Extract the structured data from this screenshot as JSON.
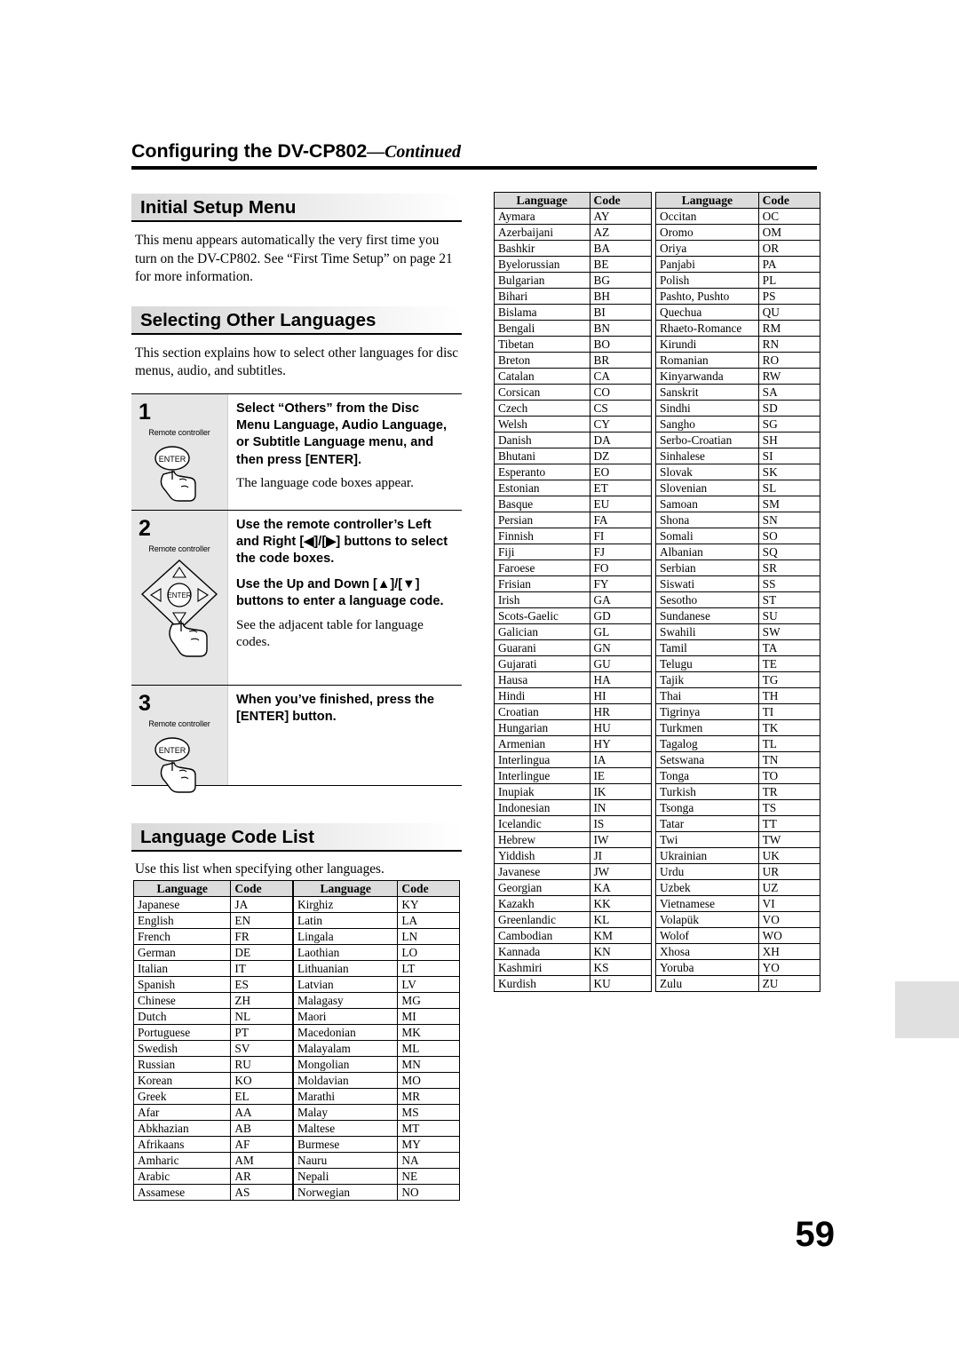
{
  "header": {
    "title": "Configuring the DV-CP802",
    "continued": "—Continued"
  },
  "sections": {
    "initial_setup": {
      "title": "Initial Setup Menu",
      "body": "This menu appears automatically the very first time you turn on the DV-CP802. See “First Time Setup” on page 21 for more information."
    },
    "selecting_other_languages": {
      "title": "Selecting Other Languages",
      "body": "This section explains how to select other languages for disc menus, audio, and subtitles."
    },
    "language_code_list": {
      "title": "Language Code List",
      "intro": "Use this list when specifying other languages."
    }
  },
  "steps": [
    {
      "number": "1",
      "remote_label": "Remote controller",
      "heading": "Select “Others” from the Disc Menu Language, Audio Language, or Subtitle Language menu, and then press [ENTER].",
      "sub": "The language code boxes appear.",
      "enter_label": "ENTER"
    },
    {
      "number": "2",
      "remote_label": "Remote controller",
      "heading": "Use the remote controller’s Left and Right [◀]/[▶] buttons to select the code boxes.",
      "heading2": "Use the Up and Down [▲]/[▼] buttons to enter a language code.",
      "sub": "See the adjacent table for language codes.",
      "enter_label": "ENTER"
    },
    {
      "number": "3",
      "remote_label": "Remote controller",
      "heading": "When you’ve finished, press the [ENTER] button.",
      "sub": "",
      "enter_label": "ENTER"
    }
  ],
  "table_headers": {
    "language": "Language",
    "code": "Code"
  },
  "tables": {
    "a": [
      [
        "Japanese",
        "JA"
      ],
      [
        "English",
        "EN"
      ],
      [
        "French",
        "FR"
      ],
      [
        "German",
        "DE"
      ],
      [
        "Italian",
        "IT"
      ],
      [
        "Spanish",
        "ES"
      ],
      [
        "Chinese",
        "ZH"
      ],
      [
        "Dutch",
        "NL"
      ],
      [
        "Portuguese",
        "PT"
      ],
      [
        "Swedish",
        "SV"
      ],
      [
        "Russian",
        "RU"
      ],
      [
        "Korean",
        "KO"
      ],
      [
        "Greek",
        "EL"
      ],
      [
        "Afar",
        "AA"
      ],
      [
        "Abkhazian",
        "AB"
      ],
      [
        "Afrikaans",
        "AF"
      ],
      [
        "Amharic",
        "AM"
      ],
      [
        "Arabic",
        "AR"
      ],
      [
        "Assamese",
        "AS"
      ]
    ],
    "b": [
      [
        "Kirghiz",
        "KY"
      ],
      [
        "Latin",
        "LA"
      ],
      [
        "Lingala",
        "LN"
      ],
      [
        "Laothian",
        "LO"
      ],
      [
        "Lithuanian",
        "LT"
      ],
      [
        "Latvian",
        "LV"
      ],
      [
        "Malagasy",
        "MG"
      ],
      [
        "Maori",
        "MI"
      ],
      [
        "Macedonian",
        "MK"
      ],
      [
        "Malayalam",
        "ML"
      ],
      [
        "Mongolian",
        "MN"
      ],
      [
        "Moldavian",
        "MO"
      ],
      [
        "Marathi",
        "MR"
      ],
      [
        "Malay",
        "MS"
      ],
      [
        "Maltese",
        "MT"
      ],
      [
        "Burmese",
        "MY"
      ],
      [
        "Nauru",
        "NA"
      ],
      [
        "Nepali",
        "NE"
      ],
      [
        "Norwegian",
        "NO"
      ]
    ],
    "c": [
      [
        "Aymara",
        "AY"
      ],
      [
        "Azerbaijani",
        "AZ"
      ],
      [
        "Bashkir",
        "BA"
      ],
      [
        "Byelorussian",
        "BE"
      ],
      [
        "Bulgarian",
        "BG"
      ],
      [
        "Bihari",
        "BH"
      ],
      [
        "Bislama",
        "BI"
      ],
      [
        "Bengali",
        "BN"
      ],
      [
        "Tibetan",
        "BO"
      ],
      [
        "Breton",
        "BR"
      ],
      [
        "Catalan",
        "CA"
      ],
      [
        "Corsican",
        "CO"
      ],
      [
        "Czech",
        "CS"
      ],
      [
        "Welsh",
        "CY"
      ],
      [
        "Danish",
        "DA"
      ],
      [
        "Bhutani",
        "DZ"
      ],
      [
        "Esperanto",
        "EO"
      ],
      [
        "Estonian",
        "ET"
      ],
      [
        "Basque",
        "EU"
      ],
      [
        "Persian",
        "FA"
      ],
      [
        "Finnish",
        "FI"
      ],
      [
        "Fiji",
        "FJ"
      ],
      [
        "Faroese",
        "FO"
      ],
      [
        "Frisian",
        "FY"
      ],
      [
        "Irish",
        "GA"
      ],
      [
        "Scots-Gaelic",
        "GD"
      ],
      [
        "Galician",
        "GL"
      ],
      [
        "Guarani",
        "GN"
      ],
      [
        "Gujarati",
        "GU"
      ],
      [
        "Hausa",
        "HA"
      ],
      [
        "Hindi",
        "HI"
      ],
      [
        "Croatian",
        "HR"
      ],
      [
        "Hungarian",
        "HU"
      ],
      [
        "Armenian",
        "HY"
      ],
      [
        "Interlingua",
        "IA"
      ],
      [
        "Interlingue",
        "IE"
      ],
      [
        "Inupiak",
        "IK"
      ],
      [
        "Indonesian",
        "IN"
      ],
      [
        "Icelandic",
        "IS"
      ],
      [
        "Hebrew",
        "IW"
      ],
      [
        "Yiddish",
        "JI"
      ],
      [
        "Javanese",
        "JW"
      ],
      [
        "Georgian",
        "KA"
      ],
      [
        "Kazakh",
        "KK"
      ],
      [
        "Greenlandic",
        "KL"
      ],
      [
        "Cambodian",
        "KM"
      ],
      [
        "Kannada",
        "KN"
      ],
      [
        "Kashmiri",
        "KS"
      ],
      [
        "Kurdish",
        "KU"
      ]
    ],
    "d": [
      [
        "Occitan",
        "OC"
      ],
      [
        "Oromo",
        "OM"
      ],
      [
        "Oriya",
        "OR"
      ],
      [
        "Panjabi",
        "PA"
      ],
      [
        "Polish",
        "PL"
      ],
      [
        "Pashto, Pushto",
        "PS"
      ],
      [
        "Quechua",
        "QU"
      ],
      [
        "Rhaeto-Romance",
        "RM"
      ],
      [
        "Kirundi",
        "RN"
      ],
      [
        "Romanian",
        "RO"
      ],
      [
        "Kinyarwanda",
        "RW"
      ],
      [
        "Sanskrit",
        "SA"
      ],
      [
        "Sindhi",
        "SD"
      ],
      [
        "Sangho",
        "SG"
      ],
      [
        "Serbo-Croatian",
        "SH"
      ],
      [
        "Sinhalese",
        "SI"
      ],
      [
        "Slovak",
        "SK"
      ],
      [
        "Slovenian",
        "SL"
      ],
      [
        "Samoan",
        "SM"
      ],
      [
        "Shona",
        "SN"
      ],
      [
        "Somali",
        "SO"
      ],
      [
        "Albanian",
        "SQ"
      ],
      [
        "Serbian",
        "SR"
      ],
      [
        "Siswati",
        "SS"
      ],
      [
        "Sesotho",
        "ST"
      ],
      [
        "Sundanese",
        "SU"
      ],
      [
        "Swahili",
        "SW"
      ],
      [
        "Tamil",
        "TA"
      ],
      [
        "Telugu",
        "TE"
      ],
      [
        "Tajik",
        "TG"
      ],
      [
        "Thai",
        "TH"
      ],
      [
        "Tigrinya",
        "TI"
      ],
      [
        "Turkmen",
        "TK"
      ],
      [
        "Tagalog",
        "TL"
      ],
      [
        "Setswana",
        "TN"
      ],
      [
        "Tonga",
        "TO"
      ],
      [
        "Turkish",
        "TR"
      ],
      [
        "Tsonga",
        "TS"
      ],
      [
        "Tatar",
        "TT"
      ],
      [
        "Twi",
        "TW"
      ],
      [
        "Ukrainian",
        "UK"
      ],
      [
        "Urdu",
        "UR"
      ],
      [
        "Uzbek",
        "UZ"
      ],
      [
        "Vietnamese",
        "VI"
      ],
      [
        "Volapük",
        "VO"
      ],
      [
        "Wolof",
        "WO"
      ],
      [
        "Xhosa",
        "XH"
      ],
      [
        "Yoruba",
        "YO"
      ],
      [
        "Zulu",
        "ZU"
      ]
    ]
  },
  "page_number": "59"
}
